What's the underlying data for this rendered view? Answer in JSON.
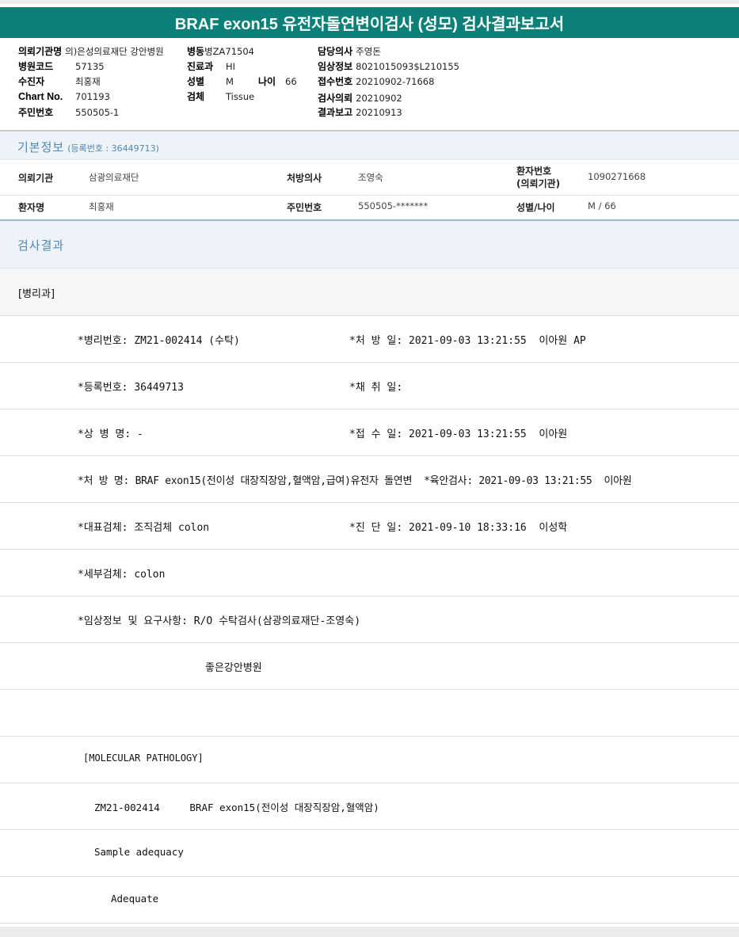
{
  "title": "BRAF exon15 유전자돌연변이검사 (성모) 검사결과보고서",
  "header": {
    "requesting_inst": {
      "label": "의뢰기관명",
      "value": "의)은성의료재단 강안병원"
    },
    "ward": {
      "label": "병동",
      "value": "병ZA71504"
    },
    "doctor": {
      "label": "담당의사",
      "value": "주영돈"
    },
    "hospital_code": {
      "label": "병원코드",
      "value": "57135"
    },
    "dept": {
      "label": "진료과",
      "value": "HI"
    },
    "clinical_info": {
      "label": "임상정보",
      "value": "8021015093$L210155"
    },
    "recipient": {
      "label": "수진자",
      "value": "최홍재"
    },
    "sex": {
      "label": "성별",
      "value": "M"
    },
    "age": {
      "label": "나이",
      "value": "66"
    },
    "receipt_no": {
      "label": "접수번호",
      "value": "20210902-71668"
    },
    "chart_no": {
      "label": "Chart No.",
      "value": "701193"
    },
    "specimen": {
      "label": "검체",
      "value": "Tissue"
    },
    "request_date": {
      "label": "검사의뢰",
      "value": "20210902"
    },
    "resident_no": {
      "label": "주민번호",
      "value": "550505-1"
    },
    "report_date": {
      "label": "결과보고",
      "value": "20210913"
    }
  },
  "basic_info": {
    "title": "기본정보",
    "sub": "(등록번호 : 36449713)",
    "row1": {
      "k1": "의뢰기관",
      "v1": "삼광의료재단",
      "k2": "처방의사",
      "v2": "조영숙",
      "k3a": "환자번호",
      "k3b": "(의뢰기관)",
      "v3": "1090271668"
    },
    "row2": {
      "k1": "환자명",
      "v1": "최홍재",
      "k2": "주민번호",
      "v2": "550505-*******",
      "k3": "성별/나이",
      "v3": "M / 66"
    }
  },
  "results": {
    "title": "검사결과",
    "dept": "[병리과]",
    "lines": [
      {
        "left": "*병리번호: ZM21-002414 (수탁)",
        "right": "*처 방 일: 2021-09-03 13:21:55  이아원 AP"
      },
      {
        "left": "*등록번호: 36449713",
        "right": "*채 취 일:"
      },
      {
        "left": "*상 병 명: -",
        "right": "*접 수 일: 2021-09-03 13:21:55  이아원"
      },
      {
        "left": "*처 방 명: BRAF exon15(전이성 대장직장암,혈액암,급여)유전자 돌연변  *육안검사: 2021-09-03 13:21:55  이아원",
        "right": ""
      },
      {
        "left": "*대표검체: 조직검체 colon",
        "right": "*진 단 일: 2021-09-10 18:33:16  이성학"
      },
      {
        "left": "*세부검체: colon",
        "right": ""
      },
      {
        "left": "*임상정보 및 요구사항: R/O 수탁검사(삼광의료재단-조영숙)",
        "right": ""
      }
    ],
    "hospital": "좋은강안병원",
    "mol_header": "[MOLECULAR PATHOLOGY]",
    "mol_line": "ZM21-002414     BRAF exon15(전이성 대장직장암,혈액암)",
    "adequacy_label": "Sample adequacy",
    "adequacy_value": "Adequate"
  }
}
